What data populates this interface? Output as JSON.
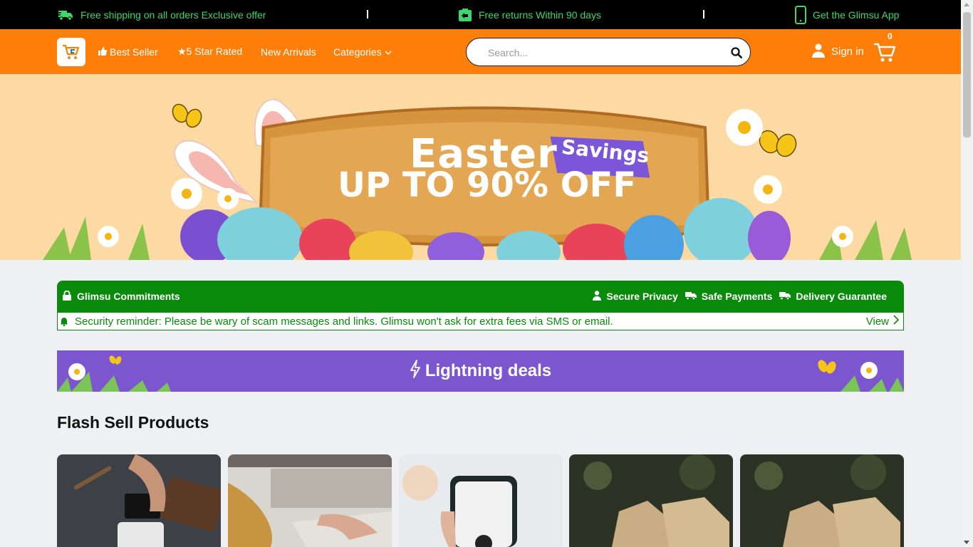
{
  "topbar": {
    "shipping_text": "Free shipping on all orders Exclusive offer",
    "separator_1": "|",
    "returns_text": "Free returns Within 90 days",
    "separator_2": "|",
    "app_text": "Get the Glimsu App",
    "text_color": "#3fd66a"
  },
  "header": {
    "brand_color": "#fd7f0a",
    "nav": {
      "best_seller": "Best Seller",
      "five_star": "★5 Star Rated",
      "new_arrivals": "New Arrivals",
      "categories": "Categories"
    },
    "search": {
      "placeholder": "Search...",
      "value": ""
    },
    "signin_label": "Sign in",
    "cart_count": "0"
  },
  "banner": {
    "title": "Easter",
    "tag": "Savings",
    "headline": "UP TO 90% OFF"
  },
  "commitments": {
    "title": "Glimsu Commitments",
    "features": [
      "Secure Privacy",
      "Safe Payments",
      "Delivery Guarantee"
    ],
    "notice": "Security reminder: Please be wary of scam messages and links. Glimsu won't ask for extra fees via SMS or email.",
    "view_label": "View",
    "color": "#0a8a0a"
  },
  "lightning": {
    "title": "Lightning deals",
    "color": "#7b56cf"
  },
  "flash_section": {
    "title": "Flash Sell Products",
    "products": [
      {
        "image": "card-payment-photo"
      },
      {
        "image": "laptop-typing-photo"
      },
      {
        "image": "phone-in-hand-photo"
      },
      {
        "image": "tan-boots-photo"
      },
      {
        "image": "tan-boots-photo"
      }
    ]
  }
}
